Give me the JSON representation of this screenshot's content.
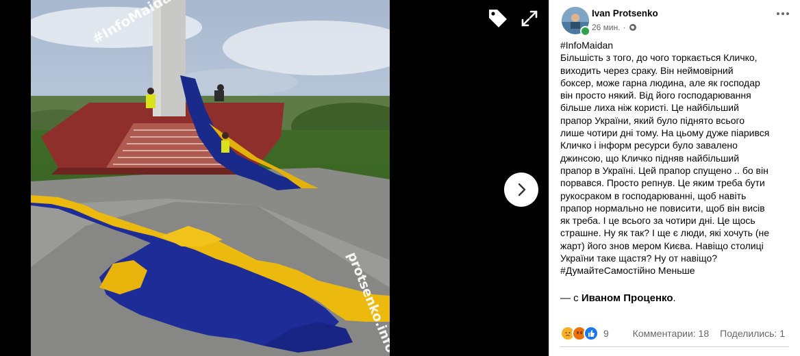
{
  "post": {
    "author": "Ivan Protsenko",
    "time": "26 мин.",
    "body_lines": [
      "#InfoMaidan",
      "Більшість з того, до чого торкається Кличко,",
      "виходить через сраку. Він неймовірний",
      "боксер, може гарна людина, але як господар",
      "він просто някий. Від його господарювання",
      "більше лиха ніж користі. Це найбільший",
      "прапор України, який було піднято всього",
      "лише чотири дні тому. На цьому дуже піарився",
      "Кличко і інформ ресурси було завалено",
      "джинсою, що Кличко підняв найбільший",
      "прапор в Україні. Цей прапор спущено .. бо він",
      "порвався. Просто репнув. Це яким треба бути",
      "рукосраком в господарюванні, щоб навіть",
      "прапор нормально не повисити, щоб він висів",
      "як треба. І це всього за чотири дні. Це щось",
      "страшне. Ну як так? І ще є люди, які хочуть (не",
      "жарт) його знов мером Києва. Навіщо столиці",
      "України таке щастя? Ну от навіщо?",
      "#ДумайтеСамостійно Меньше"
    ],
    "with_prefix": "— с",
    "with_name": "Иваном Проценко",
    "with_suffix": "."
  },
  "reactions": {
    "count": "9",
    "comments": "Комментарии: 18",
    "shares": "Поделились: 1"
  },
  "watermarks": {
    "top": "#InfoMaidan",
    "side": "protsenko.info"
  },
  "icons": {
    "tag": "tag-icon",
    "expand": "expand-icon",
    "next": "chevron-right-icon",
    "privacy": "globe-icon",
    "more": "more-icon"
  }
}
